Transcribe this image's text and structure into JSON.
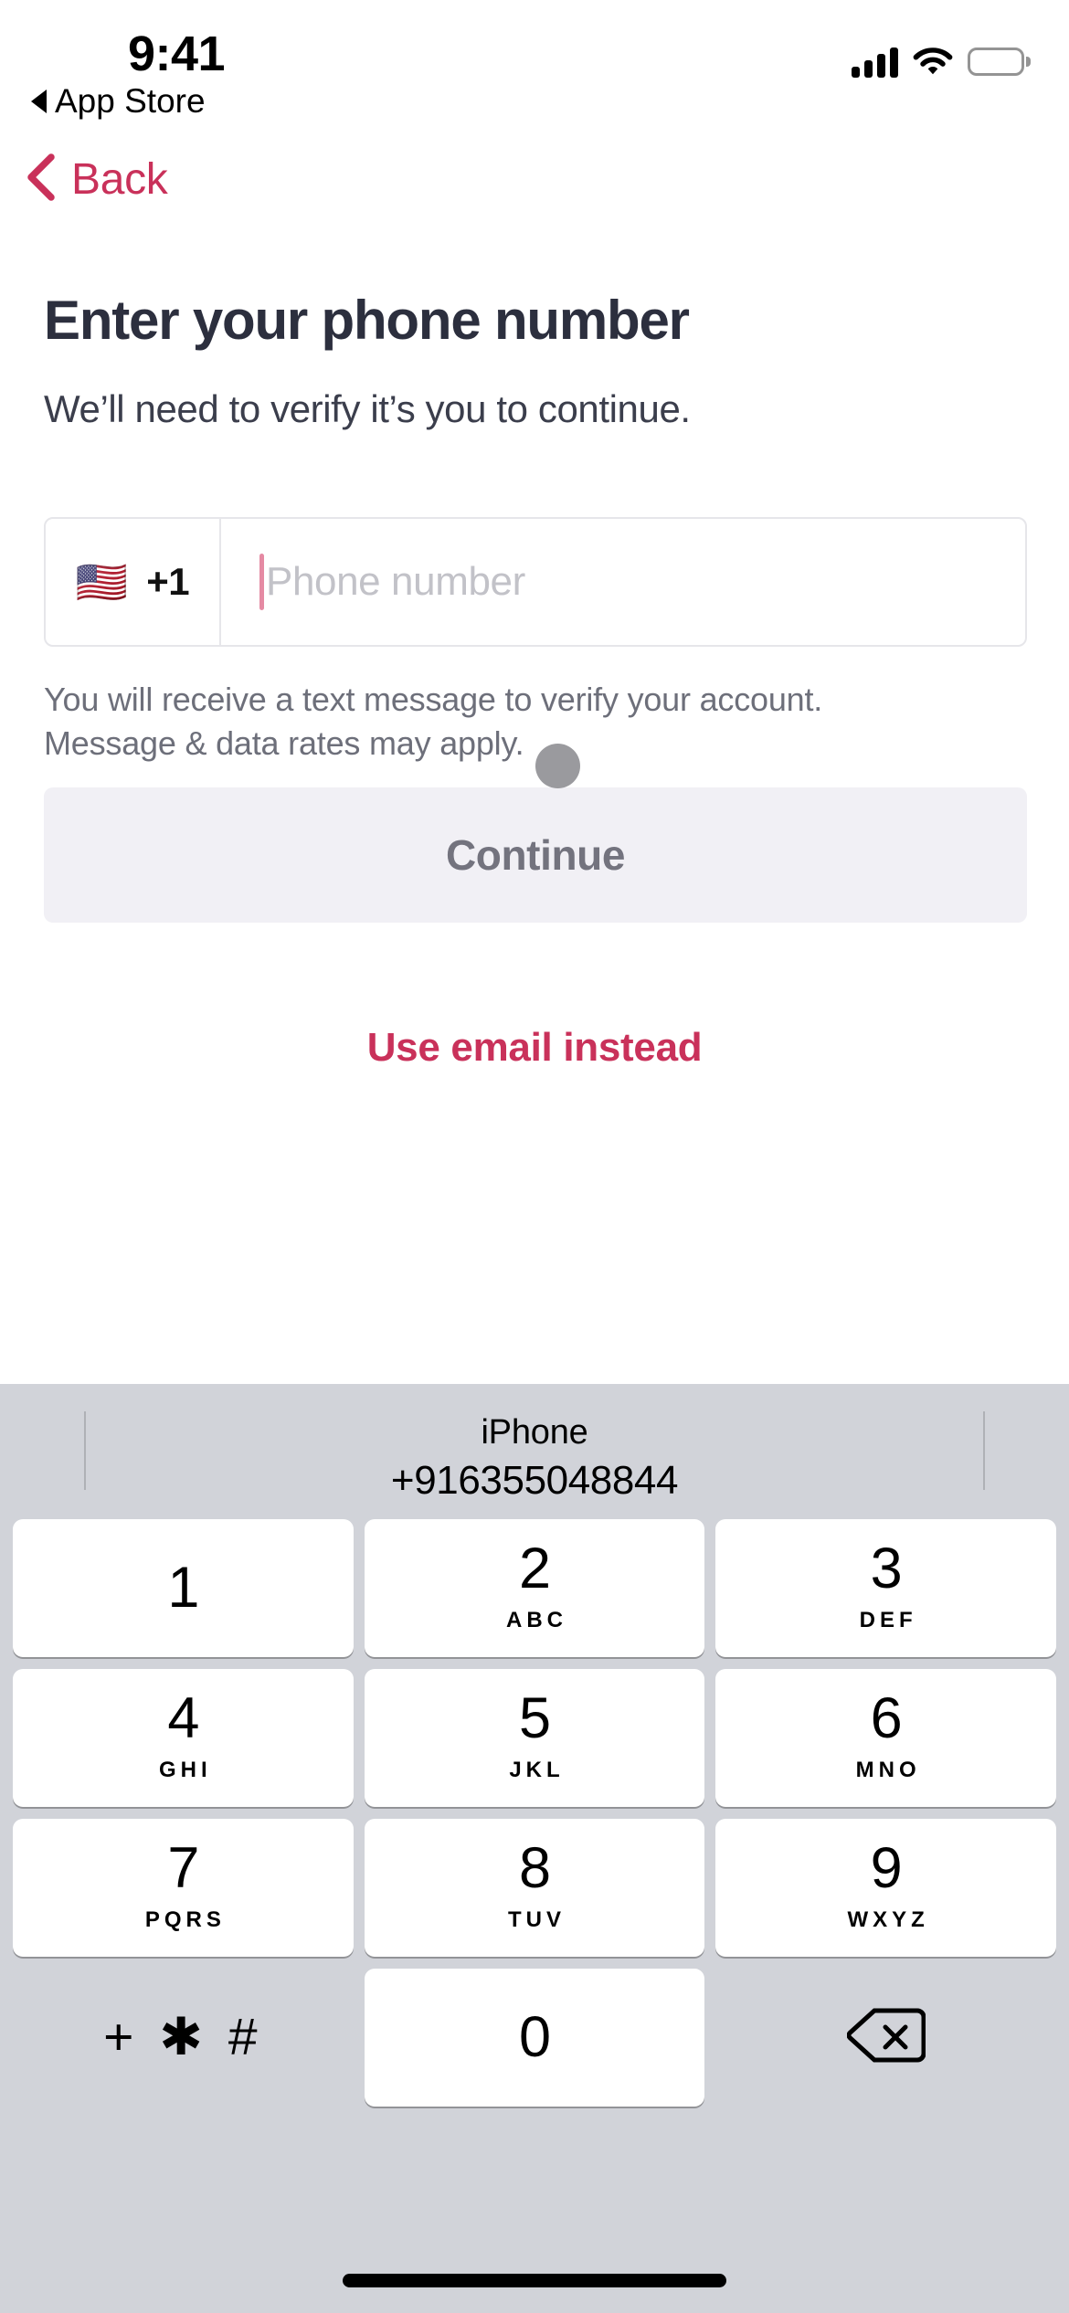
{
  "status_bar": {
    "time": "9:41",
    "return_app": "App Store",
    "return_icon": "triangle-left-icon",
    "signal_icon": "cellular-signal-icon",
    "signal_bars": 4,
    "wifi_icon": "wifi-icon",
    "battery_icon": "battery-full-icon"
  },
  "nav": {
    "back_label": "Back",
    "back_icon": "chevron-left-icon"
  },
  "main": {
    "title": "Enter your phone number",
    "subtitle": "We’ll need to verify it’s you to continue.",
    "phone_input": {
      "flag": "🇺🇸",
      "flag_name": "us-flag-icon",
      "country_code": "+1",
      "placeholder": "Phone number",
      "value": ""
    },
    "helper_line_1": "You will receive a text message to verify your account.",
    "helper_line_2": "Message & data rates may apply.",
    "continue_label": "Continue",
    "continue_enabled": false,
    "email_link_label": "Use email instead"
  },
  "keyboard": {
    "suggestion": {
      "name": "iPhone",
      "number": "+916355048844"
    },
    "rows": [
      [
        {
          "digit": "1",
          "letters": ""
        },
        {
          "digit": "2",
          "letters": "ABC"
        },
        {
          "digit": "3",
          "letters": "DEF"
        }
      ],
      [
        {
          "digit": "4",
          "letters": "GHI"
        },
        {
          "digit": "5",
          "letters": "JKL"
        },
        {
          "digit": "6",
          "letters": "MNO"
        }
      ],
      [
        {
          "digit": "7",
          "letters": "PQRS"
        },
        {
          "digit": "8",
          "letters": "TUV"
        },
        {
          "digit": "9",
          "letters": "WXYZ"
        }
      ]
    ],
    "symbols_key": "+ ✱ #",
    "zero_key": "0",
    "delete_icon": "delete-backspace-icon"
  },
  "colors": {
    "accent": "#c9315a",
    "title": "#2c2f3e",
    "keyboard_bg": "#d1d3d9",
    "key_bg": "#ffffff",
    "button_disabled_bg": "#f1f0f5",
    "button_disabled_text": "#73737e",
    "helper_text": "#6d6f7a",
    "placeholder": "#c2c2c8",
    "caret": "#e58aa3",
    "tap_indicator": "#9a9a9e"
  }
}
